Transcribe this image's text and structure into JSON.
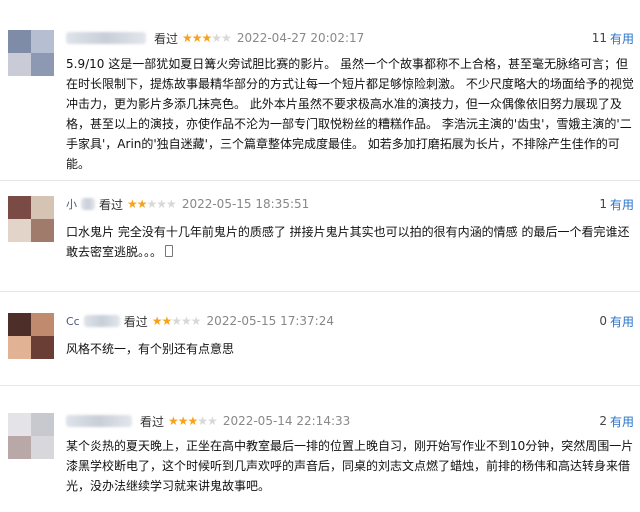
{
  "reviews": [
    {
      "username": "",
      "status": "看过",
      "rating": 3,
      "time": "2022-04-27 20:02:17",
      "useful_count": "11",
      "useful_label": "有用",
      "content": "5.9/10 这是一部犹如夏日篝火旁试胆比赛的影片。 虽然一个个故事都称不上合格，甚至毫无脉络可言；但在时长限制下，提炼故事最精华部分的方式让每一个短片都足够惊险刺激。 不少尺度略大的场面给予的视觉冲击力，更为影片多添几抹亮色。 此外本片虽然不要求极高水准的演技力，但一众偶像依旧努力展现了及格，甚至以上的演技，亦使作品不沦为一部专门取悦粉丝的糟糕作品。 李浩沅主演的'齿虫'，雪娥主演的'二手家具'，Arin的'独自迷藏'，三个篇章整体完成度最佳。 如若多加打磨拓展为长片，不排除产生佳作的可能。"
    },
    {
      "username": "小",
      "status": "看过",
      "rating": 2,
      "time": "2022-05-15 18:35:51",
      "useful_count": "1",
      "useful_label": "有用",
      "content": "口水鬼片 完全没有十几年前鬼片的质感了 拼接片鬼片其实也可以拍的很有内涵的情感 的最后一个看完谁还敢去密室逃脱。。。"
    },
    {
      "username": "Cc",
      "status": "看过",
      "rating": 2,
      "time": "2022-05-15 17:37:24",
      "useful_count": "0",
      "useful_label": "有用",
      "content": "风格不统一，有个别还有点意思"
    },
    {
      "username": "",
      "status": "看过",
      "rating": 3,
      "time": "2022-05-14 22:14:33",
      "useful_count": "2",
      "useful_label": "有用",
      "content": "某个炎热的夏天晚上，正坐在高中教室最后一排的位置上晚自习，刚开始写作业不到10分钟，突然周围一片漆黑学校断电了，这个时候听到几声欢呼的声音后，同桌的刘志文点燃了蜡烛，前排的杨伟和高达转身来借光，没办法继续学习就来讲鬼故事吧。"
    }
  ],
  "colors": {
    "star": "#f7a21b",
    "star_off": "#d8d8d8",
    "link": "#2a73c8"
  }
}
